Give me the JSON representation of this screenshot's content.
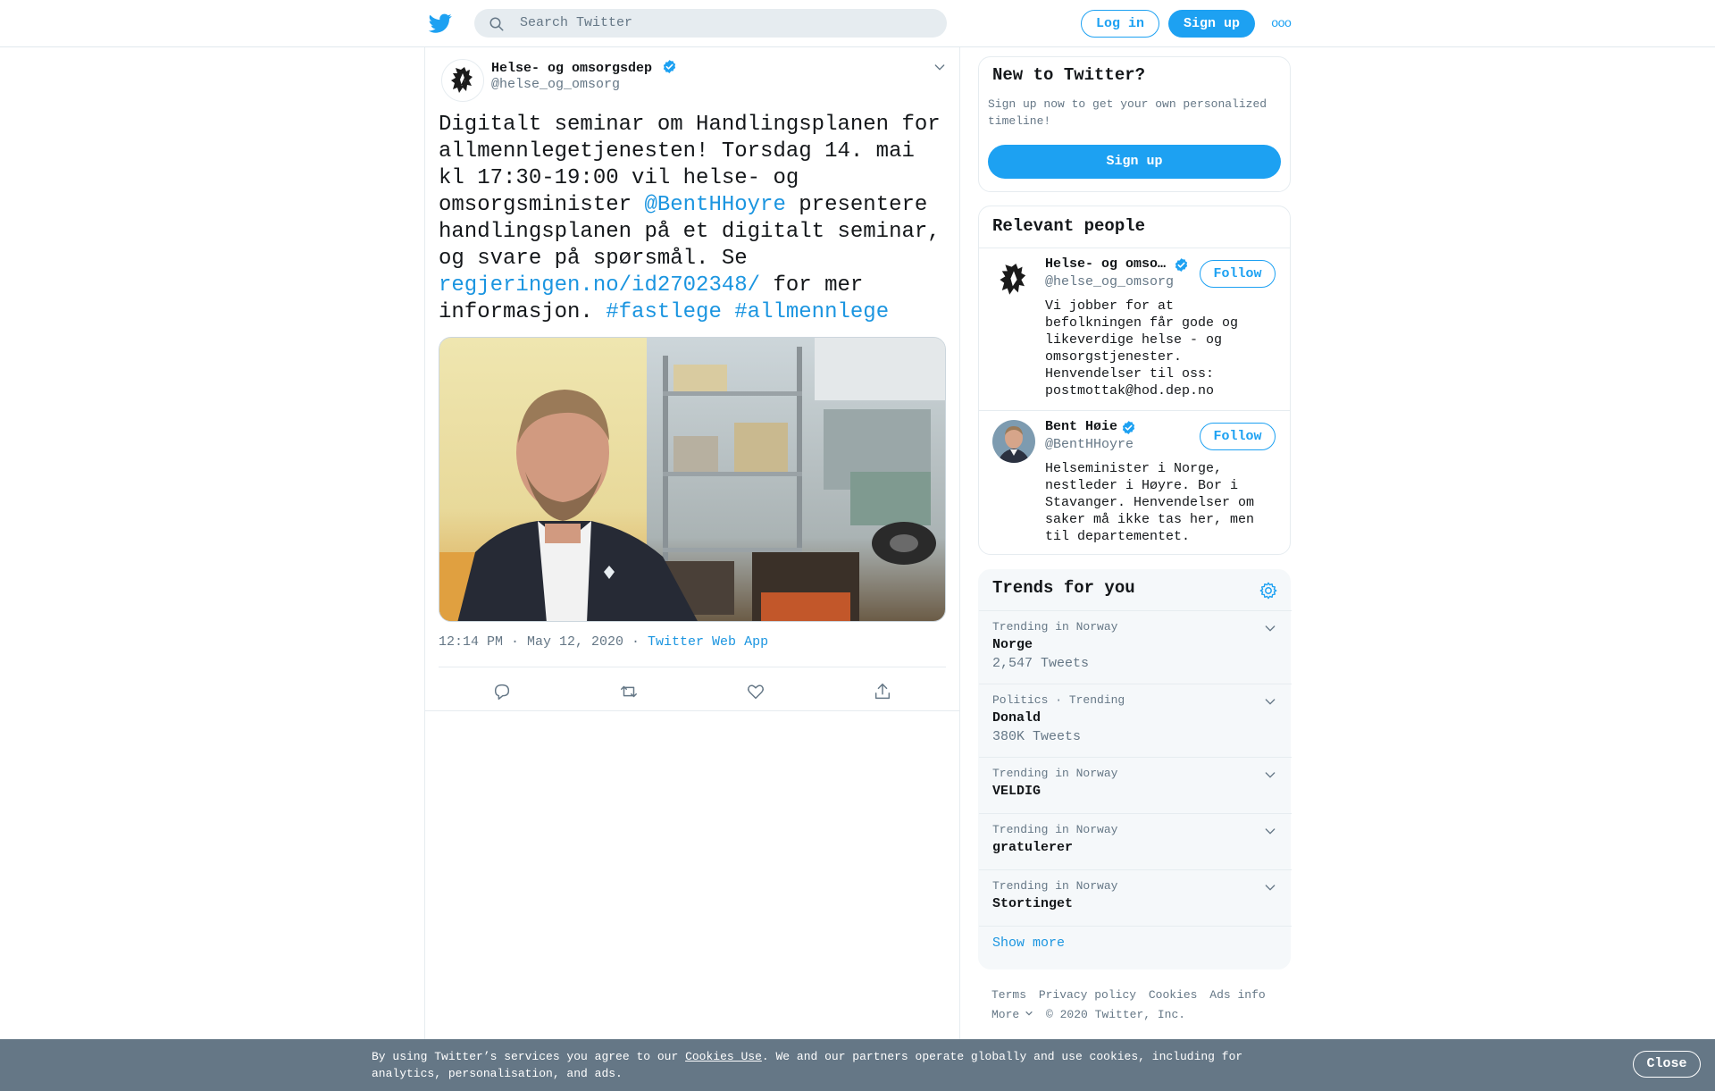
{
  "header": {
    "search_placeholder": "Search Twitter",
    "login_label": "Log in",
    "signup_label": "Sign up",
    "more_label": "ooo"
  },
  "tweet": {
    "author_name": "Helse- og omsorgsdep",
    "author_handle": "@helse_og_omsorg",
    "text_1": "Digitalt seminar om Handlingsplanen for allmennlegetjenesten! Torsdag 14. mai kl 17:30-19:00 vil helse- og omsorgsminister ",
    "mention": "@BentHHoyre",
    "text_2": " presentere handlingsplanen på et digitalt seminar, og svare på spørsmål. Se ",
    "link": "regjeringen.no/id2702348/",
    "text_3": " for mer informasjon. ",
    "hashtag_1": "#fastlege",
    "hashtag_2": "#allmennlege",
    "timestamp": "12:14 PM · May 12, 2020 · ",
    "source": "Twitter Web App"
  },
  "sidebar": {
    "new_title": "New to Twitter?",
    "new_sub": "Sign up now to get your own personalized timeline!",
    "new_signup": "Sign up",
    "people_title": "Relevant people",
    "people": [
      {
        "name": "Helse- og omsorgsdep",
        "handle": "@helse_og_omsorg",
        "bio": "Vi jobber for at befolkningen får gode og likeverdige helse - og omsorgstjenester. Henvendelser til oss: postmottak@hod.dep.no",
        "follow": "Follow"
      },
      {
        "name": "Bent Høie",
        "handle": "@BentHHoyre",
        "bio": "Helseminister i Norge, nestleder i Høyre. Bor i Stavanger. Henvendelser om saker må ikke tas her, men til departementet.",
        "follow": "Follow"
      }
    ],
    "trends_title": "Trends for you",
    "trends": [
      {
        "context": "Trending in Norway",
        "name": "Norge",
        "count": "2,547 Tweets"
      },
      {
        "context": "Politics · Trending",
        "name": "Donald",
        "count": "380K Tweets"
      },
      {
        "context": "Trending in Norway",
        "name": "VELDIG",
        "count": ""
      },
      {
        "context": "Trending in Norway",
        "name": "gratulerer",
        "count": ""
      },
      {
        "context": "Trending in Norway",
        "name": "Stortinget",
        "count": ""
      }
    ],
    "show_more": "Show more"
  },
  "footer": {
    "terms": "Terms",
    "privacy": "Privacy policy",
    "cookies": "Cookies",
    "ads": "Ads info",
    "more": "More",
    "copyright": "© 2020 Twitter, Inc."
  },
  "cookie_banner": {
    "text_1": "By using Twitter’s services you agree to our ",
    "link": "Cookies Use",
    "text_2": ". We and our partners operate globally and use cookies, including for analytics, personalisation, and ads.",
    "close": "Close"
  },
  "colors": {
    "brand": "#1da1f2",
    "link": "#1b95e0",
    "muted": "#657786",
    "banner": "#657786"
  }
}
